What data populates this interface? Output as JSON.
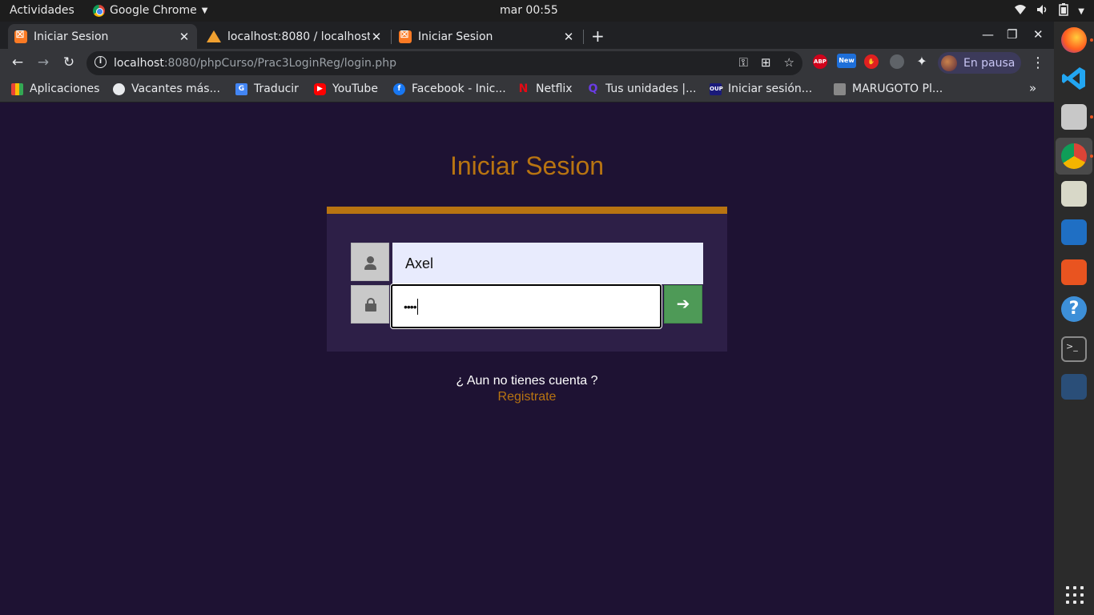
{
  "topbar": {
    "activities": "Actividades",
    "app_name": "Google Chrome",
    "clock": "mar 00:55"
  },
  "tabs": [
    {
      "title": "Iniciar Sesion",
      "favicon": "xampp-icon",
      "active": true
    },
    {
      "title": "localhost:8080 / localhost",
      "favicon": "phpmyadmin-icon",
      "active": false
    },
    {
      "title": "Iniciar Sesion",
      "favicon": "xampp-icon",
      "active": false
    }
  ],
  "toolbar": {
    "url_host": "localhost",
    "url_path": ":8080/phpCurso/Prac3LoginReg/login.php",
    "profile_label": "En pausa"
  },
  "bookmarks": [
    {
      "label": "Aplicaciones",
      "icon": "apps-grid-icon"
    },
    {
      "label": "Vacantes más...",
      "icon": "globe-icon"
    },
    {
      "label": "Traducir",
      "icon": "translate-icon"
    },
    {
      "label": "YouTube",
      "icon": "youtube-icon"
    },
    {
      "label": "Facebook - Inic...",
      "icon": "facebook-icon"
    },
    {
      "label": "Netflix",
      "icon": "netflix-icon"
    },
    {
      "label": "Tus unidades |...",
      "icon": "quizlet-icon"
    },
    {
      "label": "Iniciar sesión...",
      "icon": "oup-icon"
    },
    {
      "label": "MARUGOTO Pl...",
      "icon": "marugoto-icon"
    }
  ],
  "login": {
    "title": "Iniciar Sesion",
    "username_value": "Axel",
    "password_mask": "••••",
    "no_account_text": "¿ Aun no tienes cuenta ?",
    "register_link": "Registrate"
  },
  "colors": {
    "accent": "#b87411",
    "page_bg": "#1e1233",
    "card_bg": "#2d1f47",
    "submit_green": "#4e9a57"
  }
}
